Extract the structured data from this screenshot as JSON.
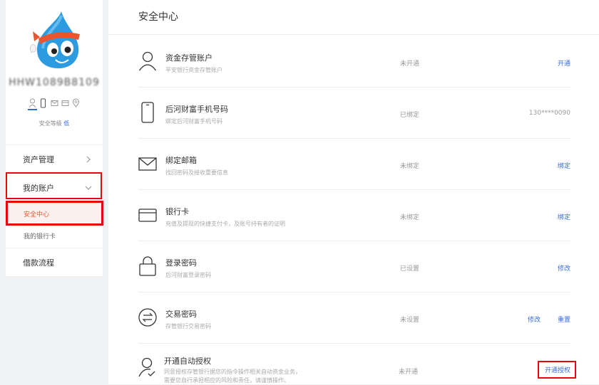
{
  "sidebar": {
    "username": "HHW1089B8109",
    "security_label": "安全等级",
    "security_level": "低",
    "nav": {
      "assets": "资产管理",
      "my_account": "我的账户",
      "security_center": "安全中心",
      "my_bank_card": "我的银行卡",
      "loan_flow": "借款流程"
    }
  },
  "main": {
    "title": "安全中心",
    "rows": [
      {
        "title": "资金存管账户",
        "desc": "平安银行资金存管账户",
        "status": "未开通",
        "action": "开通"
      },
      {
        "title": "后河财富手机号码",
        "desc": "绑定后河财富手机号码",
        "status": "已绑定",
        "value": "130****0090"
      },
      {
        "title": "绑定邮箱",
        "desc": "找回密码及接收重要信息",
        "status": "未绑定",
        "action": "绑定"
      },
      {
        "title": "银行卡",
        "desc": "充值及提现的快捷支付卡，及账号持有者的证明",
        "status": "未绑定",
        "action": "绑定"
      },
      {
        "title": "登录密码",
        "desc": "后河财富登录密码",
        "status": "已设置",
        "action": "修改"
      },
      {
        "title": "交易密码",
        "desc": "存管银行交易密码",
        "status": "未设置",
        "action": "修改",
        "action2": "重置"
      },
      {
        "title": "开通自动授权",
        "desc1": "同意授权存管银行据您的指令操作相关自动资金业务，",
        "desc2": "需要您自行承担相应的风险和责任，请谨慎操作。",
        "status": "未开通",
        "action": "开通授权"
      }
    ]
  },
  "colors": {
    "accent": "#3b6dd4",
    "highlight": "#e50a0a",
    "active_text": "#e9552f"
  },
  "icons": [
    "mascot-avatar",
    "user-verify-icon",
    "phone-verify-icon",
    "email-verify-icon",
    "card-verify-icon",
    "location-verify-icon",
    "chevron-right-icon",
    "chevron-down-icon",
    "user-icon",
    "phone-icon",
    "envelope-icon",
    "card-icon",
    "lock-icon",
    "exchange-icon",
    "user-check-icon"
  ]
}
